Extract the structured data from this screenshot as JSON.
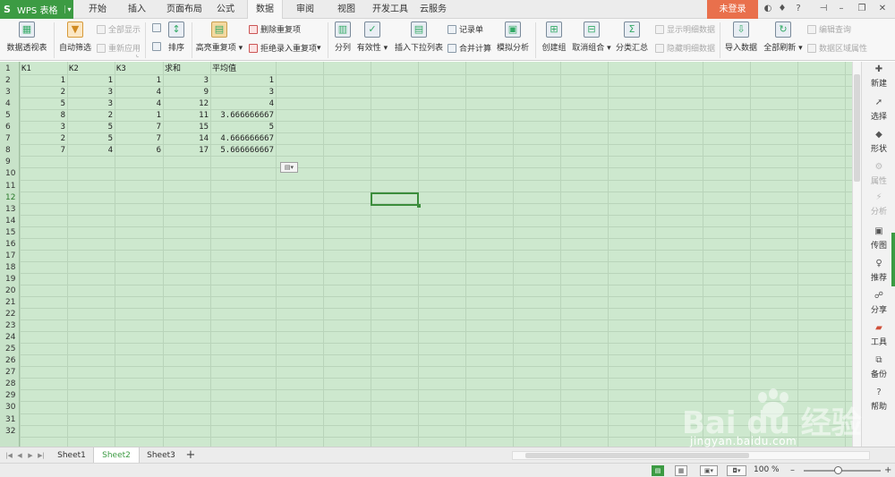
{
  "app": {
    "name": "WPS 表格",
    "logo": "S"
  },
  "tabs": [
    "开始",
    "插入",
    "页面布局",
    "公式",
    "数据",
    "审阅",
    "视图",
    "开发工具",
    "云服务"
  ],
  "active_tab": "数据",
  "login": "未登录",
  "ribbon": {
    "pivot": "数据透视表",
    "autofilter": "自动筛选",
    "show_all": "全部显示",
    "reapply": "重新应用",
    "sort": "排序",
    "highlight_dup": "高亮重复项",
    "remove_dup": "删除重复项",
    "reject_dup": "拒绝录入重复项",
    "split": "分列",
    "validity": "有效性",
    "dropdown": "插入下拉列表",
    "record": "记录单",
    "consolidate": "合并计算",
    "whatif": "模拟分析",
    "group": "创建组",
    "ungroup": "取消组合",
    "subtotal": "分类汇总",
    "show_detail": "显示明细数据",
    "hide_detail": "隐藏明细数据",
    "import": "导入数据",
    "refresh_all": "全部刷新",
    "edit_query": "编辑查询",
    "range_props": "数据区域属性"
  },
  "rows": [
    "1",
    "2",
    "3",
    "4",
    "5",
    "6",
    "7",
    "8",
    "9",
    "10",
    "11",
    "12",
    "13",
    "14",
    "15",
    "16",
    "17",
    "18",
    "19",
    "20",
    "21",
    "22",
    "23",
    "24",
    "25",
    "26",
    "27",
    "28",
    "29",
    "30",
    "31",
    "32"
  ],
  "selected_row": "12",
  "table": {
    "headers": [
      "K1",
      "K2",
      "K3",
      "求和",
      "平均值"
    ],
    "data": [
      [
        "1",
        "1",
        "1",
        "3",
        "1"
      ],
      [
        "2",
        "3",
        "4",
        "9",
        "3"
      ],
      [
        "5",
        "3",
        "4",
        "12",
        "4"
      ],
      [
        "8",
        "2",
        "1",
        "11",
        "3.666666667"
      ],
      [
        "3",
        "5",
        "7",
        "15",
        "5"
      ],
      [
        "2",
        "5",
        "7",
        "14",
        "4.666666667"
      ],
      [
        "7",
        "4",
        "6",
        "17",
        "5.666666667"
      ]
    ]
  },
  "sidebar": [
    "新建",
    "选择",
    "形状",
    "属性",
    "分析",
    "传图",
    "推荐",
    "分享",
    "工具",
    "备份",
    "帮助"
  ],
  "sheets": [
    "Sheet1",
    "Sheet2",
    "Sheet3"
  ],
  "active_sheet": "Sheet2",
  "zoom": "100 %",
  "watermark": {
    "logo": "Bai du 经验",
    "url": "jingyan.baidu.com"
  }
}
